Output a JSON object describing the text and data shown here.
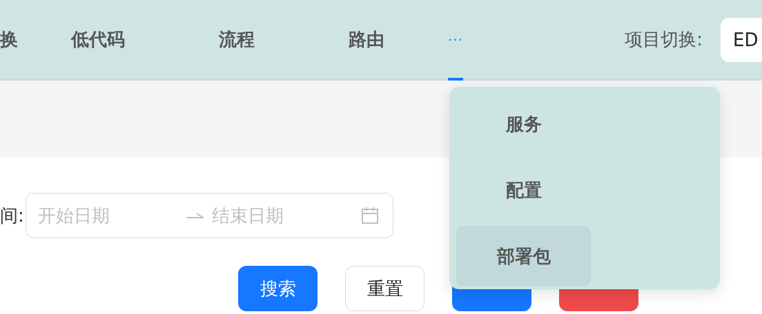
{
  "nav_tabs": [
    {
      "label": "换",
      "selected": false
    },
    {
      "label": "低代码",
      "selected": false
    },
    {
      "label": "流程",
      "selected": false
    },
    {
      "label": "路由",
      "selected": false
    },
    {
      "label": "···",
      "selected": true,
      "kind": "more"
    }
  ],
  "project_switch": {
    "label": "项目切换:",
    "value": "ED"
  },
  "filter": {
    "label": "间:",
    "start_placeholder": "开始日期",
    "end_placeholder": "结束日期"
  },
  "buttons": [
    {
      "label": "搜索",
      "kind": "primary"
    },
    {
      "label": "重置",
      "kind": "default"
    },
    {
      "kind": "primary"
    },
    {
      "kind": "danger"
    }
  ],
  "more_menu": {
    "items": [
      {
        "label": "服务",
        "selected": false
      },
      {
        "label": "配置",
        "selected": false
      },
      {
        "label": "部署包",
        "selected": true
      }
    ]
  }
}
